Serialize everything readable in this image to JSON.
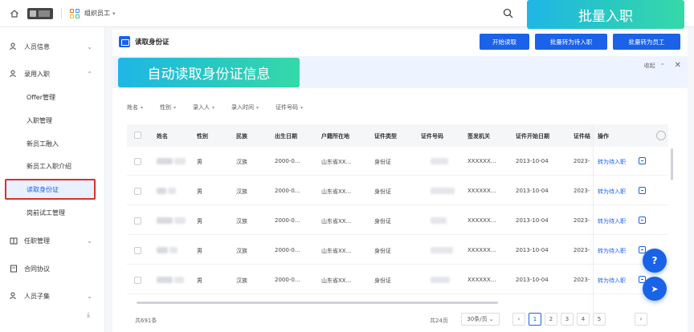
{
  "topbar": {
    "org_title": "组织员工",
    "chev": "▾"
  },
  "sidebar": {
    "items": [
      {
        "label": "人员信息",
        "arrow": "⌄"
      },
      {
        "label": "录用入职",
        "arrow": "⌃"
      },
      {
        "label": "任职管理",
        "arrow": "⌄"
      },
      {
        "label": "合同协议",
        "arrow": ""
      },
      {
        "label": "人员子集",
        "arrow": "⌄"
      }
    ],
    "sub_items": [
      {
        "label": "Offer管理"
      },
      {
        "label": "入职管理"
      },
      {
        "label": "新员工融入"
      },
      {
        "label": "新员工入职介绍"
      },
      {
        "label": "读取身份证"
      },
      {
        "label": "岗前试工管理"
      }
    ],
    "collapse_glyph": "⤓"
  },
  "page": {
    "title": "读取身份证",
    "buttons": [
      "开始读取",
      "批量转为待入职",
      "批量转为员工"
    ],
    "info_tools": {
      "collapse": "收起",
      "chev": "⌃",
      "close": "✕"
    }
  },
  "filters": [
    {
      "label": "姓名"
    },
    {
      "label": "性别"
    },
    {
      "label": "录入人"
    },
    {
      "label": "录入时间"
    },
    {
      "label": "证件号码"
    }
  ],
  "table": {
    "headers": [
      "姓名",
      "性别",
      "民族",
      "出生日期",
      "户籍所在地",
      "证件类型",
      "证件号码",
      "签发机关",
      "证件开始日期",
      "证件结",
      "操作"
    ],
    "rows": [
      {
        "gender": "男",
        "ethnicity": "汉族",
        "birth": "2000-0...",
        "domicile": "山东省XX...",
        "id_type": "身份证",
        "authority": "XXXXXX...",
        "start_date": "2013-10-04",
        "end_date": "2023-",
        "action": "转为待入职"
      },
      {
        "gender": "男",
        "ethnicity": "汉族",
        "birth": "2000-0...",
        "domicile": "山东省XX...",
        "id_type": "身份证",
        "authority": "XXXXXX...",
        "start_date": "2013-10-04",
        "end_date": "2023-",
        "action": "转为待入职"
      },
      {
        "gender": "男",
        "ethnicity": "汉族",
        "birth": "2000-0...",
        "domicile": "山东省XX...",
        "id_type": "身份证",
        "authority": "XXXXXX...",
        "start_date": "2013-10-04",
        "end_date": "2023-",
        "action": "转为待入职"
      },
      {
        "gender": "男",
        "ethnicity": "汉族",
        "birth": "2000-0...",
        "domicile": "山东省XX...",
        "id_type": "身份证",
        "authority": "XXXXXX...",
        "start_date": "2013-10-04",
        "end_date": "2023-",
        "action": "转为待入职"
      },
      {
        "gender": "男",
        "ethnicity": "汉族",
        "birth": "2000-0...",
        "domicile": "山东省XX...",
        "id_type": "身份证",
        "authority": "XXXXXX...",
        "start_date": "2013-10-04",
        "end_date": "2023-",
        "action": "转为待入职"
      }
    ]
  },
  "pagination": {
    "total": "共691条",
    "pages_total": "共24页",
    "page_size": "30条/页 ⌄",
    "prev": "‹",
    "pages": [
      "1",
      "2",
      "3",
      "4",
      "5"
    ],
    "next": "›"
  },
  "fab": {
    "help": "?",
    "send": "➤"
  },
  "callouts": {
    "top": "批量入职",
    "mid": "自动读取身份证信息"
  },
  "colors": {
    "accent": "#1a62e8",
    "active_border": "#d9312c"
  }
}
